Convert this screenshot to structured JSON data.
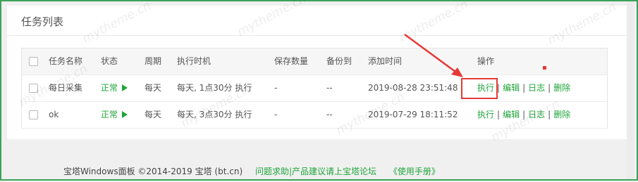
{
  "panel": {
    "title": "任务列表"
  },
  "table": {
    "headers": {
      "name": "任务名称",
      "status": "状态",
      "cycle": "周期",
      "exec_time": "执行时机",
      "save_count": "保存数量",
      "backup_to": "备份到",
      "add_time": "添加时间",
      "ops": "操作"
    },
    "rows": [
      {
        "name": "每日采集",
        "status": "正常",
        "cycle": "每天",
        "exec_time": "每天, 1点30分 执行",
        "save_count": "-",
        "backup_to": "--",
        "add_time": "2019-08-28 23:51:48",
        "ops": {
          "run": "执行",
          "edit": "编辑",
          "log": "日志",
          "delete": "删除",
          "sep": "|"
        }
      },
      {
        "name": "ok",
        "status": "正常",
        "cycle": "每天",
        "exec_time": "每天, 3点30分 执行",
        "save_count": "-",
        "backup_to": "--",
        "add_time": "2019-07-29 18:11:52",
        "ops": {
          "run": "执行",
          "edit": "编辑",
          "log": "日志",
          "delete": "删除",
          "sep": "|"
        }
      }
    ]
  },
  "footer": {
    "copyright": "宝塔Windows面板 ©2014-2019 宝塔 (bt.cn)",
    "help_link": "问题求助|产品建议请上宝塔论坛",
    "manual_link": "《使用手册》"
  },
  "watermark": "mytheme.cn",
  "colors": {
    "accent": "#20a53a",
    "annotation": "#e53935",
    "frame": "#3aa35a"
  }
}
